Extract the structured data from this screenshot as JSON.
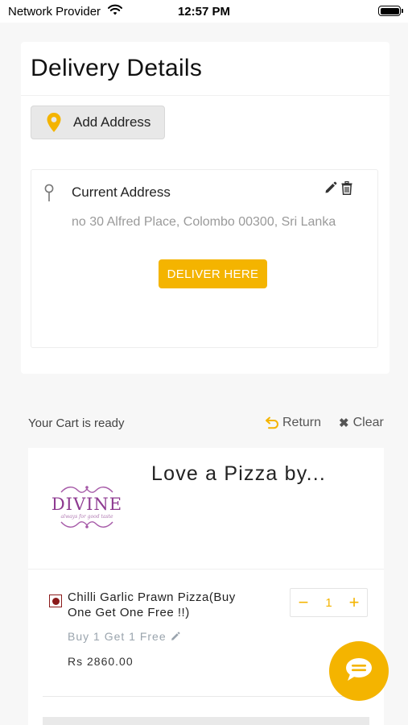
{
  "status_bar": {
    "provider": "Network Provider",
    "time": "12:57 PM",
    "icons": [
      "wifi-icon",
      "battery-icon"
    ]
  },
  "delivery": {
    "title": "Delivery Details",
    "add_address_label": "Add Address",
    "address": {
      "title": "Current Address",
      "text": "no 30 Alfred Place, Colombo 00300, Sri Lanka",
      "deliver_label": "DELIVER HERE"
    }
  },
  "cart": {
    "ready_label": "Your Cart is ready",
    "return_label": "Return",
    "clear_label": "Clear",
    "restaurant": {
      "name": "Love a Pizza by...",
      "logo_text": "DIVINE",
      "logo_tagline": "always for good taste"
    },
    "items": [
      {
        "name": "Chilli Garlic Prawn Pizza(Buy One Get One Free !!)",
        "offer": "Buy 1 Get 1 Free",
        "price": "Rs 2860.00",
        "quantity": "1",
        "minus": "−",
        "plus": "+"
      }
    ]
  },
  "colors": {
    "accent": "#f4b400",
    "nonveg_badge": "#8b1a1a",
    "logo": "#8e3b91"
  }
}
